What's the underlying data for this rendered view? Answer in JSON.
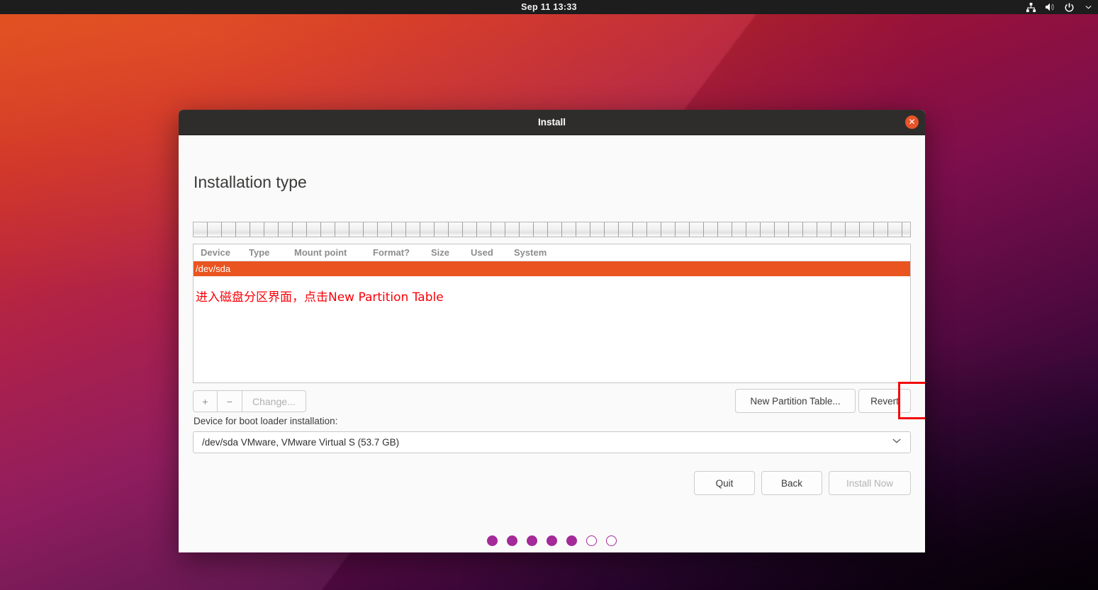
{
  "topbar": {
    "clock": "Sep 11  13:33",
    "tray_icons": [
      "network-icon",
      "volume-icon",
      "power-icon",
      "chevron-down-icon"
    ]
  },
  "window": {
    "title": "Install",
    "close_label": "✕"
  },
  "page": {
    "title": "Installation type"
  },
  "partition_table": {
    "columns": [
      "Device",
      "Type",
      "Mount point",
      "Format?",
      "Size",
      "Used",
      "System"
    ],
    "rows": [
      {
        "device": "/dev/sda",
        "type": "",
        "mount_point": "",
        "format": "",
        "size": "",
        "used": "",
        "system": "",
        "selected": true
      }
    ],
    "annotation": "进入磁盘分区界面，点击New Partition Table"
  },
  "tool_buttons": {
    "add_label": "+",
    "remove_label": "−",
    "change_label": "Change..."
  },
  "partition_actions": {
    "new_partition_table_label": "New Partition Table...",
    "revert_label": "Revert"
  },
  "bootloader": {
    "label": "Device for boot loader installation:",
    "selected": "/dev/sda VMware, VMware Virtual S (53.7 GB)",
    "chevron": "⌄"
  },
  "footer": {
    "quit_label": "Quit",
    "back_label": "Back",
    "install_now_label": "Install Now"
  },
  "progress": {
    "total": 7,
    "completed": 5,
    "states": [
      "filled",
      "filled",
      "filled",
      "filled",
      "filled",
      "hollow",
      "hollow"
    ]
  },
  "colors": {
    "ubuntu_orange": "#e95420",
    "annotation_red": "#f20a0a",
    "progress_purple": "#a32a98",
    "titlebar": "#2f2d2c"
  }
}
